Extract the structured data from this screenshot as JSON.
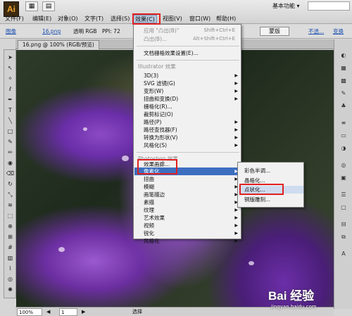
{
  "app": {
    "logo": "Ai",
    "workspace_label": "基本功能 ▾"
  },
  "menu": [
    {
      "label": "文件(F)"
    },
    {
      "label": "编辑(E)"
    },
    {
      "label": "对象(O)"
    },
    {
      "label": "文字(T)"
    },
    {
      "label": "选择(S)"
    },
    {
      "label": "效果(C)"
    },
    {
      "label": "视图(V)"
    },
    {
      "label": "窗口(W)"
    },
    {
      "label": "帮助(H)"
    }
  ],
  "control": {
    "image_label": "图像",
    "file_link": "16.png",
    "mode": "透明 RGB",
    "ppi": "PPI: 72",
    "style_button": "蒙版",
    "opacity_link": "不透...",
    "more_link": "变换"
  },
  "document": {
    "tab_title": "16.png @ 100% (RGB/预览)"
  },
  "effect_menu": {
    "apply_last": {
      "label": "应用 \"凸出(B)\"",
      "shortcut": "Shift+Ctrl+E"
    },
    "last": {
      "label": "凸出(B)...",
      "shortcut": "Alt+Shift+Ctrl+E"
    },
    "doc_raster": "文档栅格效果设置(E)...",
    "illustrator_header": "Illustrator 效果",
    "illustrator_items": [
      "3D(3)",
      "SVG 滤镜(G)",
      "变形(W)",
      "扭曲和变换(D)",
      "栅格化(R)...",
      "裁剪标记(O)",
      "路径(P)",
      "路径查找器(F)",
      "转换为形状(V)",
      "风格化(S)"
    ],
    "photoshop_header": "Photoshop 效果",
    "photoshop_items": [
      "效果画廊...",
      "像素化",
      "扭曲",
      "模糊",
      "画笔描边",
      "素描",
      "纹理",
      "艺术效果",
      "视频",
      "锐化",
      "风格化"
    ]
  },
  "submenu": {
    "items": [
      "彩色半调...",
      "晶格化...",
      "点状化...",
      "铜版雕刻..."
    ]
  },
  "status": {
    "zoom": "100%",
    "page": "1",
    "tool": "选择"
  },
  "watermark": {
    "logo": "Bai 经验",
    "url": "jingyan.baidu.com"
  }
}
